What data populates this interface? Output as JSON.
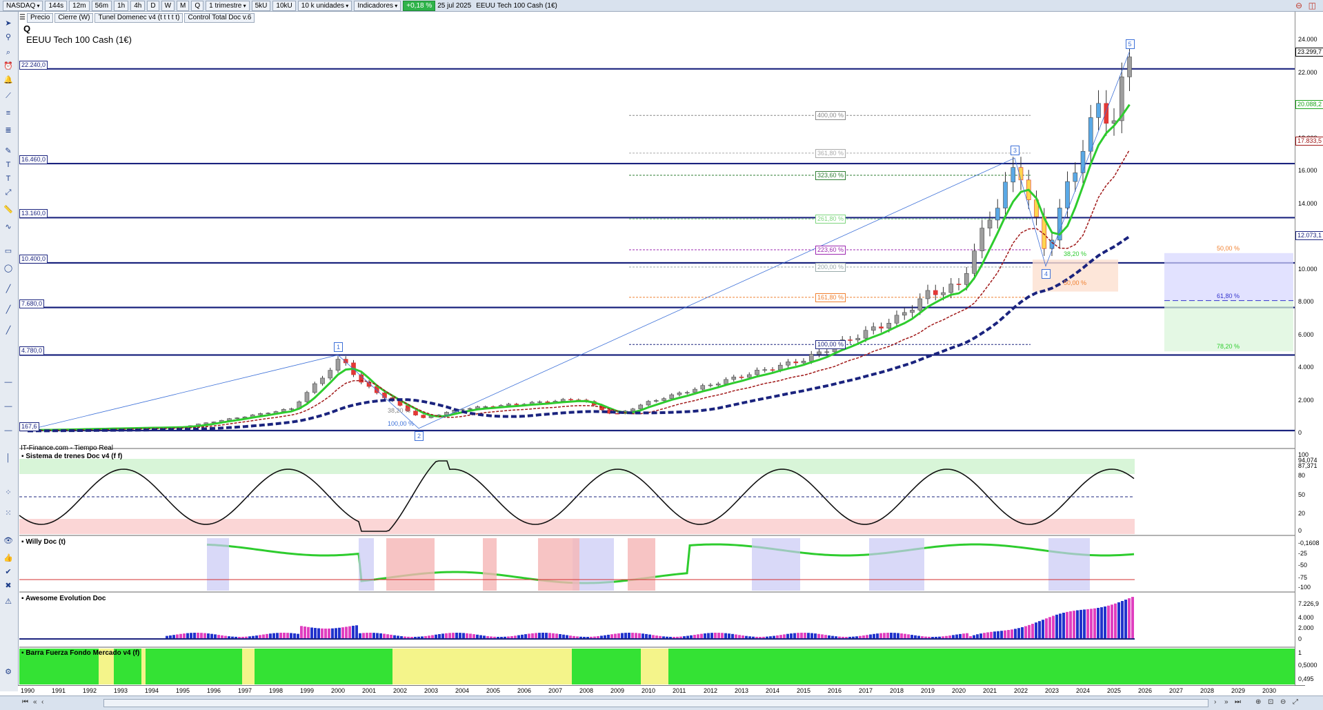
{
  "toolbar": {
    "exchange": "NASDAQ",
    "timeframes": [
      "144s",
      "12m",
      "56m",
      "1h",
      "4h",
      "D",
      "W",
      "M",
      "Q"
    ],
    "period": "1 trimestre",
    "size_buttons": [
      "5kU",
      "10kU"
    ],
    "units": "10 k unidades",
    "indicators": "Indicadores",
    "change": "+0,18 %",
    "date": "25 jul 2025",
    "symbol": "EEUU Tech 100 Cash (1€)"
  },
  "legend": [
    "Precio",
    "Cierre (W)",
    "Tunel Domenec v4 (t t t t t)",
    "Control Total Doc v.6"
  ],
  "header": {
    "period_letter": "Q",
    "title": "EEUU Tech 100 Cash (1€)"
  },
  "source_label": "IT-Finance.com - Tiempo Real",
  "price_axis": {
    "ticks": [
      "24.000",
      "22.000",
      "20.000",
      "18.000",
      "16.000",
      "14.000",
      "12.000",
      "10.000",
      "8.000",
      "6.000",
      "4.000",
      "2.000",
      "0"
    ],
    "tags": [
      {
        "label": "23.299,7",
        "color": "#000000"
      },
      {
        "label": "20.088,2",
        "color": "#1aa51a"
      },
      {
        "label": "17.833,5",
        "color": "#a01818"
      },
      {
        "label": "12.073,1",
        "color": "#1a237e"
      }
    ]
  },
  "levels": [
    "22.240,0",
    "16.460,0",
    "13.160,0",
    "10.400,0",
    "7.680,0",
    "4.780,0",
    "167,6"
  ],
  "fib_left": [
    "400,00 %",
    "361,80 %",
    "323,60 %",
    "261,80 %",
    "223,60 %",
    "200,00 %",
    "161,80 %",
    "100,00 %"
  ],
  "fib_right": [
    "50,00 %",
    "61,80 %",
    "78,20 %"
  ],
  "fib_mid": [
    "38,20 %",
    "50,00 %"
  ],
  "fib_low": [
    "38,20 %",
    "100,00 %"
  ],
  "waves": [
    "1",
    "2",
    "3",
    "4",
    "5"
  ],
  "x_axis": [
    "1990",
    "1991",
    "1992",
    "1993",
    "1994",
    "1995",
    "1996",
    "1997",
    "1998",
    "1999",
    "2000",
    "2001",
    "2002",
    "2003",
    "2004",
    "2005",
    "2006",
    "2007",
    "2008",
    "2009",
    "2010",
    "2011",
    "2012",
    "2013",
    "2014",
    "2015",
    "2016",
    "2017",
    "2018",
    "2019",
    "2020",
    "2021",
    "2022",
    "2023",
    "2024",
    "2025",
    "2026",
    "2027",
    "2028",
    "2029",
    "2030"
  ],
  "panels": {
    "trains": {
      "name": "Sistema de trenes Doc v4 (f f)",
      "ticks": [
        "100",
        "94,074",
        "87,371",
        "80",
        "50",
        "20",
        "0"
      ]
    },
    "willy": {
      "name": "Willy Doc (t)",
      "ticks": [
        "-0,1608",
        "-25",
        "-50",
        "-75",
        "-100"
      ]
    },
    "awesome": {
      "name": "Awesome Evolution Doc",
      "ticks": [
        "7.226,9",
        "4.000",
        "2.000",
        "0"
      ]
    },
    "barra": {
      "name": "Barra Fuerza Fondo Mercado v4 (f)",
      "ticks": [
        "1",
        "0,5000",
        "0,495"
      ]
    }
  },
  "colors": {
    "bull": "#2e7d32",
    "bear": "#d32f2f",
    "level": "#1a237e",
    "ma_green": "#2ecc2e",
    "ma_red": "#a01818",
    "ma_blue": "#1a237e"
  }
}
